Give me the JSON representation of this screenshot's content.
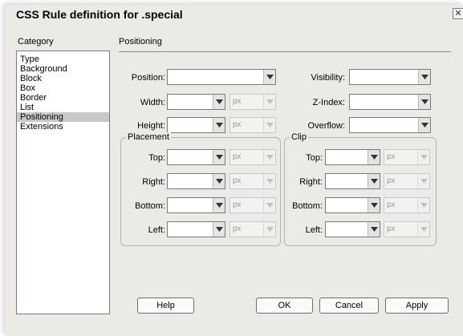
{
  "window": {
    "title": "CSS Rule definition for .special"
  },
  "category": {
    "header": "Category",
    "items": [
      "Type",
      "Background",
      "Block",
      "Box",
      "Border",
      "List",
      "Positioning",
      "Extensions"
    ],
    "selected": "Positioning"
  },
  "panel": {
    "title": "Positioning"
  },
  "labels": {
    "position": "Position:",
    "width": "Width:",
    "height": "Height:",
    "visibility": "Visibility:",
    "z_index": "Z-Index:",
    "overflow": "Overflow:",
    "top": "Top:",
    "right": "Right:",
    "bottom": "Bottom:",
    "left": "Left:"
  },
  "fields": {
    "position": "",
    "visibility": "",
    "z_index": "",
    "overflow": "",
    "width": "",
    "height": "",
    "unit": "px"
  },
  "placement": {
    "legend": "Placement",
    "top": "",
    "right": "",
    "bottom": "",
    "left": "",
    "unit": "px"
  },
  "clip": {
    "legend": "Clip",
    "top": "",
    "right": "",
    "bottom": "",
    "left": "",
    "unit": "px"
  },
  "buttons": {
    "help": "Help",
    "ok": "OK",
    "cancel": "Cancel",
    "apply": "Apply"
  },
  "icons": {
    "dropdown": "chevron-down-icon",
    "close": "close-icon"
  }
}
